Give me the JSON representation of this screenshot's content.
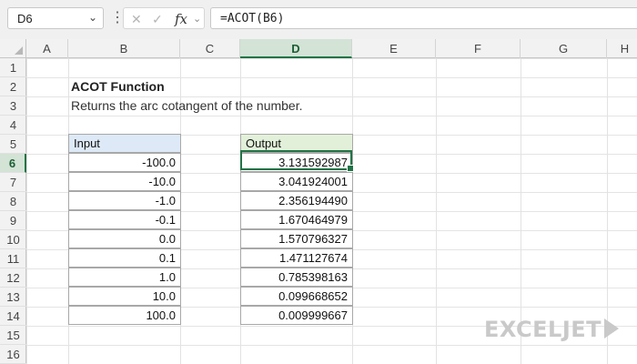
{
  "name_box": {
    "value": "D6"
  },
  "formula_bar": {
    "formula": "=ACOT(B6)",
    "fx_label": "fx"
  },
  "columns": [
    "A",
    "B",
    "C",
    "D",
    "E",
    "F",
    "G",
    "H"
  ],
  "selected_column": "D",
  "rows": [
    "1",
    "2",
    "3",
    "4",
    "5",
    "6",
    "7",
    "8",
    "9",
    "10",
    "11",
    "12",
    "13",
    "14",
    "15",
    "16"
  ],
  "selected_row": "6",
  "sheet": {
    "title": "ACOT Function",
    "subtitle": "Returns the arc cotangent of the number.",
    "input_header": "Input",
    "output_header": "Output",
    "inputs": [
      "-100.0",
      "-10.0",
      "-1.0",
      "-0.1",
      "0.0",
      "0.1",
      "1.0",
      "10.0",
      "100.0"
    ],
    "outputs": [
      "3.131592987",
      "3.041924001",
      "2.356194490",
      "1.670464979",
      "1.570796327",
      "1.471127674",
      "0.785398163",
      "0.099668652",
      "0.009999667"
    ]
  },
  "logo": {
    "text": "EXCELJET",
    "color": "#c9c9c9"
  },
  "colors": {
    "accent": "#217346",
    "input_header_bg": "#dde9f6",
    "output_header_bg": "#e3f0d9"
  }
}
